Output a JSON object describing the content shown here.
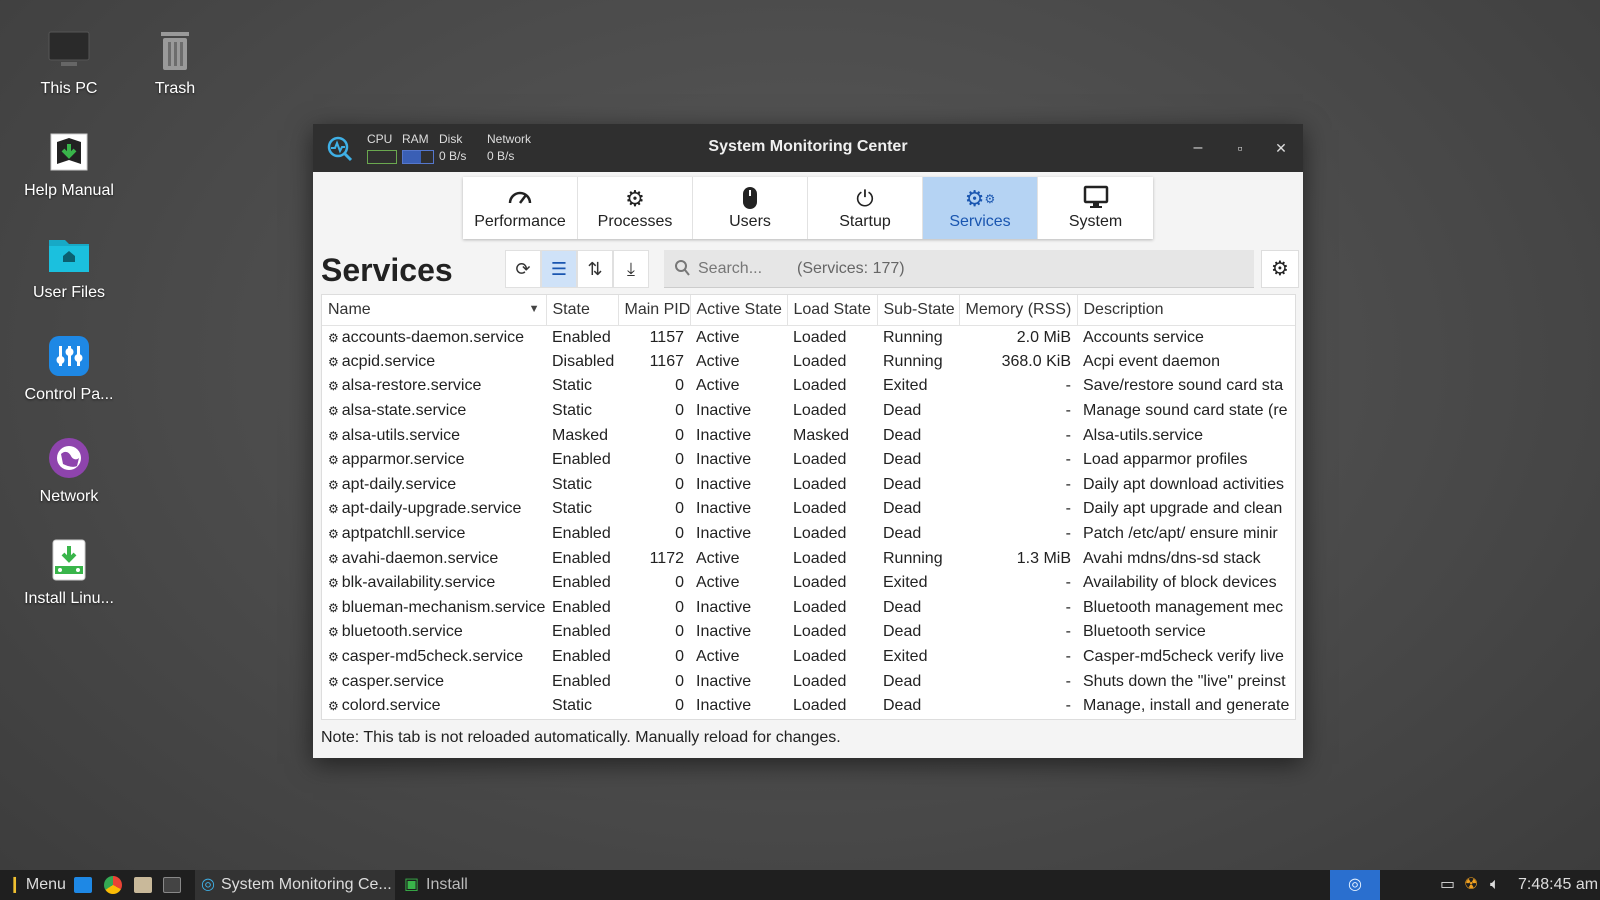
{
  "desktop": {
    "icons": [
      {
        "label": "This PC"
      },
      {
        "label": "Trash"
      },
      {
        "label": "Help Manual"
      },
      {
        "label": "User Files"
      },
      {
        "label": "Control Pa..."
      },
      {
        "label": "Network"
      },
      {
        "label": "Install Linu..."
      }
    ]
  },
  "window": {
    "title": "System Monitoring Center",
    "mini": {
      "cpu_label": "CPU",
      "ram_label": "RAM",
      "disk_label": "Disk",
      "disk_value": "0 B/s",
      "network_label": "Network",
      "network_value": "0 B/s"
    },
    "buttons": {
      "minimize": "–",
      "maximize": "▫",
      "close": "✕"
    }
  },
  "tabs": [
    {
      "label": "Performance",
      "icon": "gauge-icon"
    },
    {
      "label": "Processes",
      "icon": "gear-icon"
    },
    {
      "label": "Users",
      "icon": "mouse-icon"
    },
    {
      "label": "Startup",
      "icon": "power-icon"
    },
    {
      "label": "Services",
      "icon": "gears-icon",
      "active": true
    },
    {
      "label": "System",
      "icon": "monitor-icon"
    }
  ],
  "services": {
    "heading": "Services",
    "search_placeholder": "Search...",
    "count_text": "(Services: 177)",
    "columns": [
      "Name",
      "State",
      "Main PID",
      "Active State",
      "Load State",
      "Sub-State",
      "Memory (RSS)",
      "Description"
    ],
    "rows": [
      [
        "accounts-daemon.service",
        "Enabled",
        "1157",
        "Active",
        "Loaded",
        "Running",
        "2.0 MiB",
        "Accounts service"
      ],
      [
        "acpid.service",
        "Disabled",
        "1167",
        "Active",
        "Loaded",
        "Running",
        "368.0 KiB",
        "Acpi event daemon"
      ],
      [
        "alsa-restore.service",
        "Static",
        "0",
        "Active",
        "Loaded",
        "Exited",
        "-",
        "Save/restore sound card sta"
      ],
      [
        "alsa-state.service",
        "Static",
        "0",
        "Inactive",
        "Loaded",
        "Dead",
        "-",
        "Manage sound card state (re"
      ],
      [
        "alsa-utils.service",
        "Masked",
        "0",
        "Inactive",
        "Masked",
        "Dead",
        "-",
        "Alsa-utils.service"
      ],
      [
        "apparmor.service",
        "Enabled",
        "0",
        "Inactive",
        "Loaded",
        "Dead",
        "-",
        "Load apparmor profiles"
      ],
      [
        "apt-daily.service",
        "Static",
        "0",
        "Inactive",
        "Loaded",
        "Dead",
        "-",
        "Daily apt download activities"
      ],
      [
        "apt-daily-upgrade.service",
        "Static",
        "0",
        "Inactive",
        "Loaded",
        "Dead",
        "-",
        "Daily apt upgrade and clean"
      ],
      [
        "aptpatchll.service",
        "Enabled",
        "0",
        "Inactive",
        "Loaded",
        "Dead",
        "-",
        "Patch /etc/apt/ ensure minir"
      ],
      [
        "avahi-daemon.service",
        "Enabled",
        "1172",
        "Active",
        "Loaded",
        "Running",
        "1.3 MiB",
        "Avahi mdns/dns-sd stack"
      ],
      [
        "blk-availability.service",
        "Enabled",
        "0",
        "Active",
        "Loaded",
        "Exited",
        "-",
        "Availability of block devices"
      ],
      [
        "blueman-mechanism.service",
        "Enabled",
        "0",
        "Inactive",
        "Loaded",
        "Dead",
        "-",
        "Bluetooth management mec"
      ],
      [
        "bluetooth.service",
        "Enabled",
        "0",
        "Inactive",
        "Loaded",
        "Dead",
        "-",
        "Bluetooth service"
      ],
      [
        "casper-md5check.service",
        "Enabled",
        "0",
        "Active",
        "Loaded",
        "Exited",
        "-",
        "Casper-md5check verify live"
      ],
      [
        "casper.service",
        "Enabled",
        "0",
        "Inactive",
        "Loaded",
        "Dead",
        "-",
        "Shuts down the \"live\" preinst"
      ],
      [
        "colord.service",
        "Static",
        "0",
        "Inactive",
        "Loaded",
        "Dead",
        "-",
        "Manage, install and generate"
      ]
    ],
    "note": "Note: This tab is not reloaded automatically. Manually reload for changes."
  },
  "taskbar": {
    "menu_label": "Menu",
    "app_task_label": "System Monitoring Ce...",
    "install_task_label": "Install",
    "clock": "7:48:45 am"
  },
  "colors": {
    "accent": "#1a56b0",
    "active_tab_bg": "#b5d3f3",
    "titlebar": "#2f2f2f"
  }
}
